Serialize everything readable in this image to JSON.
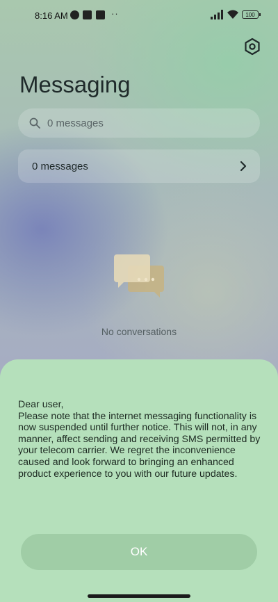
{
  "status_bar": {
    "time": "8:16 AM",
    "dots": "··",
    "battery": "100"
  },
  "header": {
    "title": "Messaging",
    "settings_icon": "gear-icon"
  },
  "search": {
    "placeholder": "0 messages"
  },
  "messages_card": {
    "label": "0 messages"
  },
  "empty_state": {
    "text": "No conversations"
  },
  "dialog": {
    "message": "Dear user,\nPlease note that the internet messaging functionality is now suspended until further notice. This will not, in any manner, affect sending and receiving SMS permitted by your telecom carrier. We regret the inconvenience caused and look forward to bringing an enhanced product experience to you with our future updates.",
    "ok_label": "OK"
  },
  "colors": {
    "sheet": "#b5e0bb",
    "empty_icon_front": "#e6d9b8",
    "empty_icon_back": "#c9b27a"
  }
}
